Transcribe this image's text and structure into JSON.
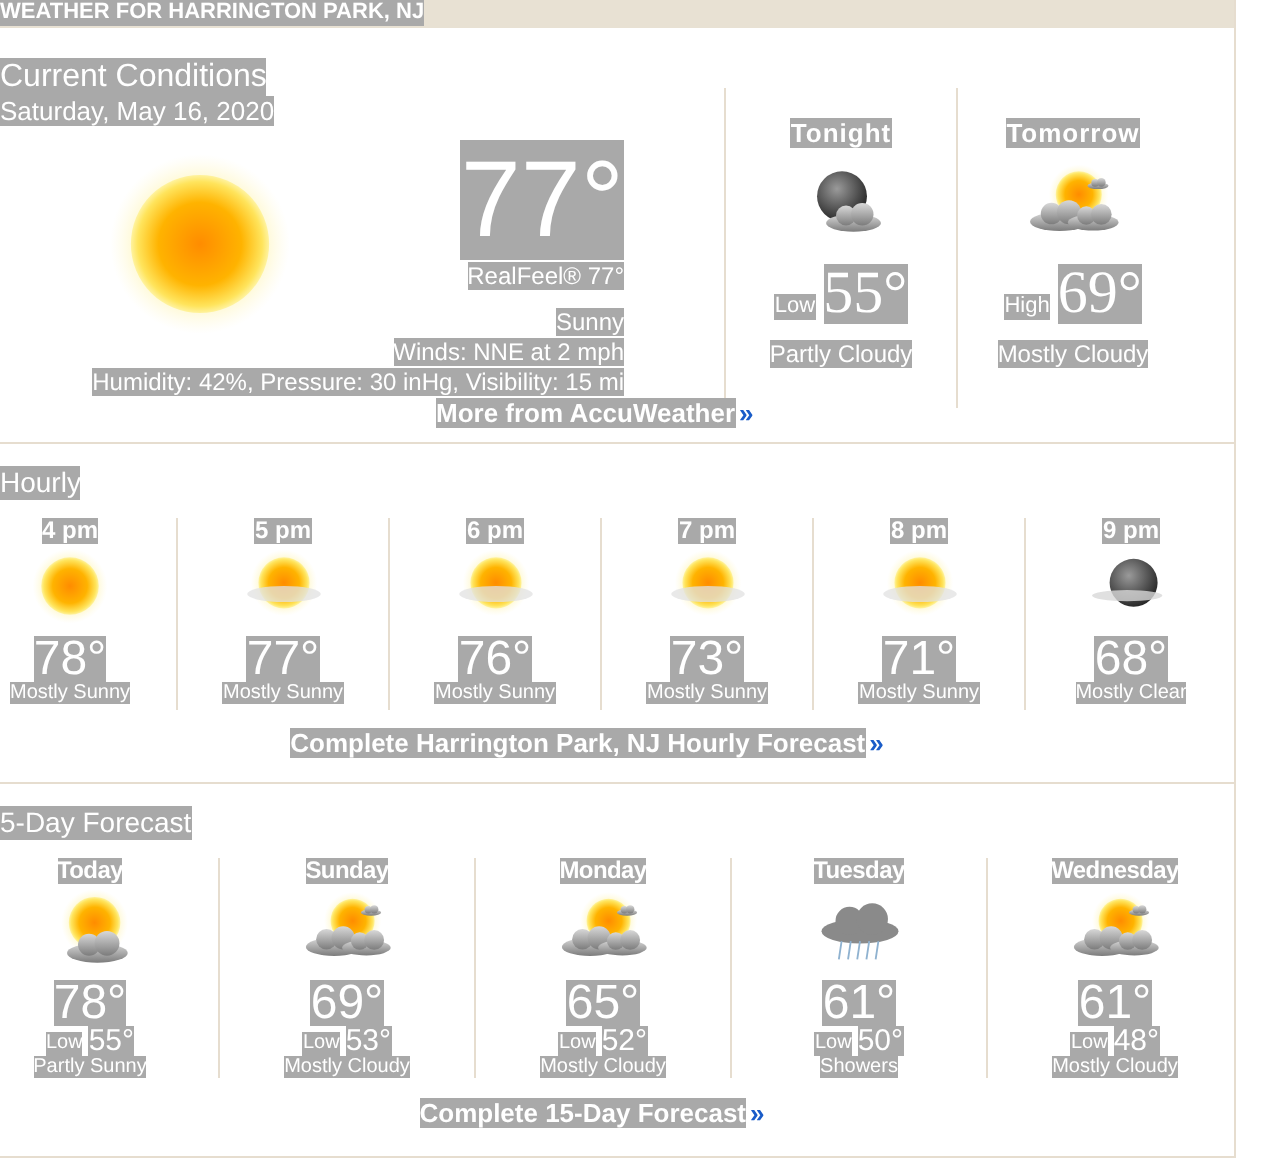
{
  "header": {
    "title": "WEATHER FOR HARRINGTON PARK, NJ"
  },
  "current": {
    "title": "Current Conditions",
    "date": "Saturday, May 16, 2020",
    "kind": "sunny",
    "temp": "77°",
    "realfeel": "RealFeel® 77°",
    "condition": "Sunny",
    "winds": "Winds: NNE at 2 mph",
    "details": "Humidity: 42%, Pressure: 30 inHg, Visibility: 15 mi"
  },
  "outlook": [
    {
      "label": "Tonight",
      "kind": "night-cloudy",
      "temp_label": "Low",
      "temp": "55°",
      "condition": "Partly Cloudy"
    },
    {
      "label": "Tomorrow",
      "kind": "mostly-cloudy",
      "temp_label": "High",
      "temp": "69°",
      "condition": "Mostly Cloudy"
    }
  ],
  "more_link": {
    "text": "More from AccuWeather",
    "arrow": "»"
  },
  "hourly": {
    "title": "Hourly",
    "items": [
      {
        "time": "4 pm",
        "kind": "sunny",
        "temp": "78°",
        "condition": "Mostly Sunny"
      },
      {
        "time": "5 pm",
        "kind": "hazy-sun",
        "temp": "77°",
        "condition": "Mostly Sunny"
      },
      {
        "time": "6 pm",
        "kind": "hazy-sun",
        "temp": "76°",
        "condition": "Mostly Sunny"
      },
      {
        "time": "7 pm",
        "kind": "hazy-sun",
        "temp": "73°",
        "condition": "Mostly Sunny"
      },
      {
        "time": "8 pm",
        "kind": "hazy-sun",
        "temp": "71°",
        "condition": "Mostly Sunny"
      },
      {
        "time": "9 pm",
        "kind": "night-clear",
        "temp": "68°",
        "condition": "Mostly Clear"
      }
    ],
    "link": {
      "text": "Complete Harrington Park, NJ Hourly Forecast",
      "arrow": "»"
    }
  },
  "daily": {
    "title": "5-Day Forecast",
    "items": [
      {
        "day": "Today",
        "kind": "partly-sunny",
        "high": "78°",
        "low_label": "Low",
        "low": "55°",
        "condition": "Partly Sunny"
      },
      {
        "day": "Sunday",
        "kind": "mostly-cloudy",
        "high": "69°",
        "low_label": "Low",
        "low": "53°",
        "condition": "Mostly Cloudy"
      },
      {
        "day": "Monday",
        "kind": "mostly-cloudy",
        "high": "65°",
        "low_label": "Low",
        "low": "52°",
        "condition": "Mostly Cloudy"
      },
      {
        "day": "Tuesday",
        "kind": "showers",
        "high": "61°",
        "low_label": "Low",
        "low": "50°",
        "condition": "Showers"
      },
      {
        "day": "Wednesday",
        "kind": "mostly-cloudy",
        "high": "61°",
        "low_label": "Low",
        "low": "48°",
        "condition": "Mostly Cloudy"
      }
    ],
    "link": {
      "text": "Complete 15-Day Forecast",
      "arrow": "»"
    }
  }
}
